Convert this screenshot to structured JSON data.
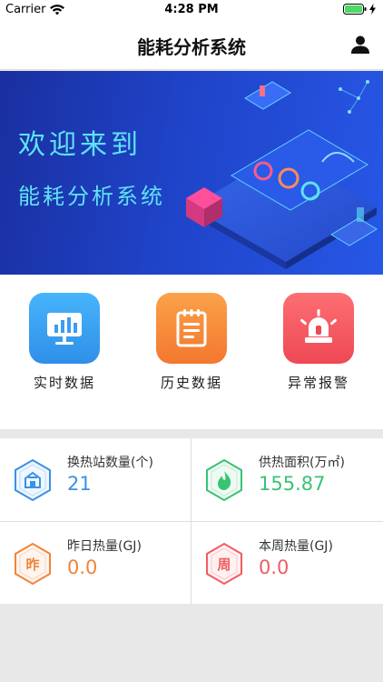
{
  "status_bar": {
    "carrier": "Carrier",
    "time": "4:28 PM"
  },
  "nav": {
    "title": "能耗分析系统"
  },
  "banner": {
    "line1": "欢迎来到",
    "line2": "能耗分析系统"
  },
  "menu": [
    {
      "label": "实时数据",
      "icon": "monitor-chart-icon",
      "color": "#3a9df2"
    },
    {
      "label": "历史数据",
      "icon": "notepad-icon",
      "color": "#f7923b"
    },
    {
      "label": "异常报警",
      "icon": "alarm-light-icon",
      "color": "#f25561"
    }
  ],
  "stats": [
    {
      "label": "换热站数量(个)",
      "value": "21",
      "color": "#3a91e6",
      "glyph": "building-icon"
    },
    {
      "label": "供热面积(万㎡)",
      "value": "155.87",
      "color": "#39c374",
      "glyph": "flame-icon"
    },
    {
      "label": "昨日热量(GJ)",
      "value": "0.0",
      "color": "#f0843a",
      "glyph_text": "昨"
    },
    {
      "label": "本周热量(GJ)",
      "value": "0.0",
      "color": "#ef5d63",
      "glyph_text": "周"
    }
  ]
}
